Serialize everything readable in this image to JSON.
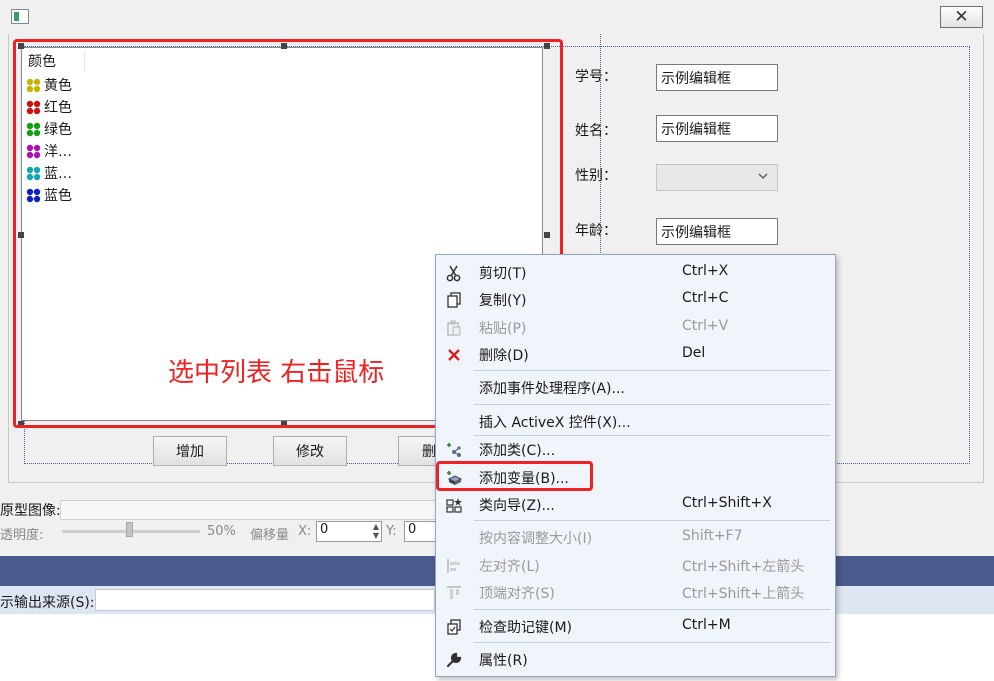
{
  "dialog": {
    "close_glyph": "✕"
  },
  "listbox": {
    "column_header": "颜色",
    "items": [
      {
        "label": "黄色",
        "color": "#c8b400"
      },
      {
        "label": "红色",
        "color": "#d01010"
      },
      {
        "label": "绿色",
        "color": "#10a010"
      },
      {
        "label": "洋…",
        "color": "#b010b0"
      },
      {
        "label": "蓝…",
        "color": "#10a8b0"
      },
      {
        "label": "蓝色",
        "color": "#1020c0"
      }
    ]
  },
  "annotation": "选中列表 右击鼠标",
  "buttons": {
    "add": "增加",
    "modify": "修改",
    "delete_partial": "删"
  },
  "form": {
    "student_id_label": "学号：",
    "student_id_value": "示例编辑框",
    "name_label": "姓名：",
    "name_value": "示例编辑框",
    "gender_label": "性别：",
    "age_label": "年龄：",
    "age_value": "示例编辑框"
  },
  "properties": {
    "image_label": "原型图像:",
    "opacity_label": "透明度:",
    "opacity_value": "50%",
    "offset_label": "偏移量",
    "offset_x_label": "X:",
    "offset_x_value": "0",
    "offset_y_label": "Y:",
    "offset_y_value": "0",
    "output_source_label": "示输出来源(S):"
  },
  "context_menu": {
    "items": [
      {
        "label": "剪切(T)",
        "shortcut": "Ctrl+X",
        "icon": "scissors-icon",
        "disabled": false
      },
      {
        "label": "复制(Y)",
        "shortcut": "Ctrl+C",
        "icon": "copy-icon",
        "disabled": false
      },
      {
        "label": "粘贴(P)",
        "shortcut": "Ctrl+V",
        "icon": "paste-icon",
        "disabled": true
      },
      {
        "label": "删除(D)",
        "shortcut": "Del",
        "icon": "delete-x-icon",
        "disabled": false
      },
      {
        "label": "添加事件处理程序(A)...",
        "shortcut": "",
        "icon": "",
        "disabled": false
      },
      {
        "label": "插入 ActiveX 控件(X)...",
        "shortcut": "",
        "icon": "",
        "disabled": false
      },
      {
        "label": "添加类(C)...",
        "shortcut": "",
        "icon": "add-class-icon",
        "disabled": false
      },
      {
        "label": "添加变量(B)...",
        "shortcut": "",
        "icon": "add-variable-icon",
        "disabled": false
      },
      {
        "label": "类向导(Z)...",
        "shortcut": "Ctrl+Shift+X",
        "icon": "class-wizard-icon",
        "disabled": false
      },
      {
        "label": "按内容调整大小(I)",
        "shortcut": "Shift+F7",
        "icon": "",
        "disabled": true
      },
      {
        "label": "左对齐(L)",
        "shortcut": "Ctrl+Shift+左箭头",
        "icon": "align-left-icon",
        "disabled": true
      },
      {
        "label": "顶端对齐(S)",
        "shortcut": "Ctrl+Shift+上箭头",
        "icon": "align-top-icon",
        "disabled": true
      },
      {
        "label": "检查助记键(M)",
        "shortcut": "Ctrl+M",
        "icon": "check-mnemonics-icon",
        "disabled": false
      },
      {
        "label": "属性(R)",
        "shortcut": "",
        "icon": "wrench-icon",
        "disabled": false
      }
    ]
  }
}
